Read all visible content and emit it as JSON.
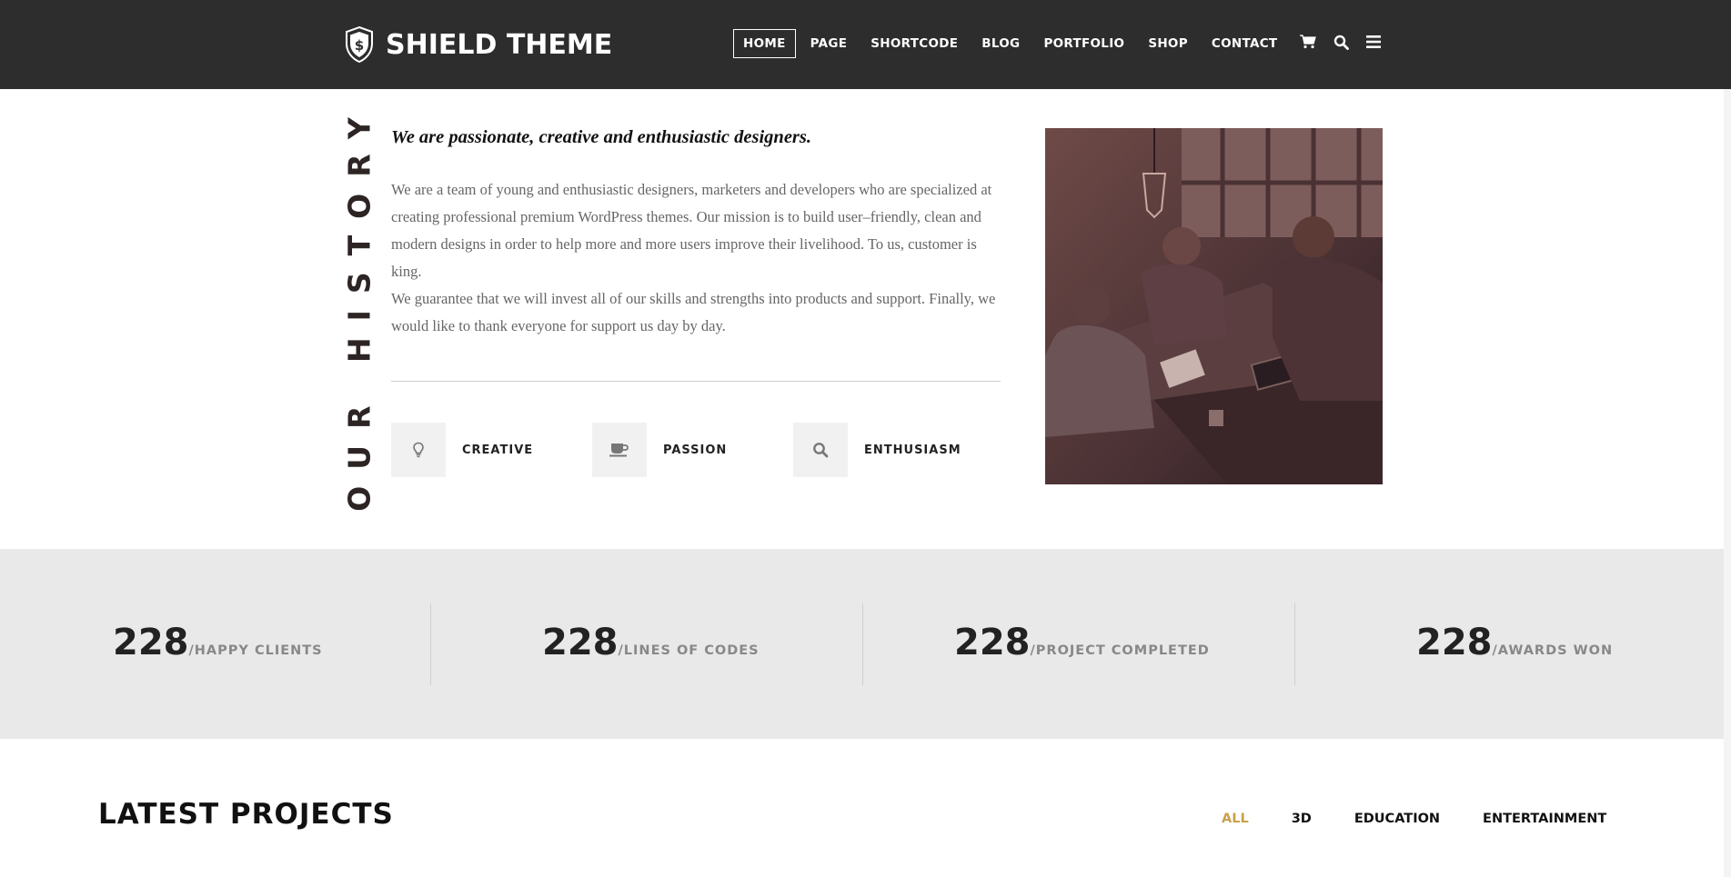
{
  "brand": {
    "name": "SHIELD THEME",
    "logo_letter": "$"
  },
  "nav": {
    "items": [
      {
        "label": "HOME",
        "active": true
      },
      {
        "label": "PAGE",
        "active": false
      },
      {
        "label": "SHORTCODE",
        "active": false
      },
      {
        "label": "BLOG",
        "active": false
      },
      {
        "label": "PORTFOLIO",
        "active": false
      },
      {
        "label": "SHOP",
        "active": false
      },
      {
        "label": "CONTACT",
        "active": false
      }
    ],
    "icons": [
      "cart-icon",
      "search-icon",
      "menu-icon"
    ]
  },
  "history": {
    "vertical_title": "OUR HISTORY",
    "heading": "We are passionate, creative and enthusiastic designers.",
    "paragraphs": [
      "We are a team of young and enthusiastic designers, marketers and developers who are specialized at creating professional premium WordPress themes. Our mission is to build user–friendly, clean and modern designs in order to help more and more users improve their livelihood. To us, customer is king.",
      "We guarantee that we will invest all of our skills and strengths into products and support. Finally, we would like to thank everyone for support us day by day."
    ],
    "features": [
      {
        "label": "CREATIVE",
        "icon": "lightbulb-icon"
      },
      {
        "label": "PASSION",
        "icon": "coffee-cup-icon"
      },
      {
        "label": "ENTHUSIASM",
        "icon": "search-icon"
      }
    ]
  },
  "stats": [
    {
      "number": "228",
      "label": "/HAPPY CLIENTS"
    },
    {
      "number": "228",
      "label": "/LINES OF CODES"
    },
    {
      "number": "228",
      "label": "/PROJECT COMPLETED"
    },
    {
      "number": "228",
      "label": "/AWARDS WON"
    }
  ],
  "projects": {
    "title": "LATEST PROJECTS",
    "filters": [
      {
        "label": "ALL",
        "active": true
      },
      {
        "label": "3D",
        "active": false
      },
      {
        "label": "EDUCATION",
        "active": false
      },
      {
        "label": "ENTERTAINMENT",
        "active": false
      }
    ]
  },
  "colors": {
    "header_bg": "#2d2d2d",
    "accent": "#c9a04a",
    "stats_bg": "#e9e9e9"
  }
}
